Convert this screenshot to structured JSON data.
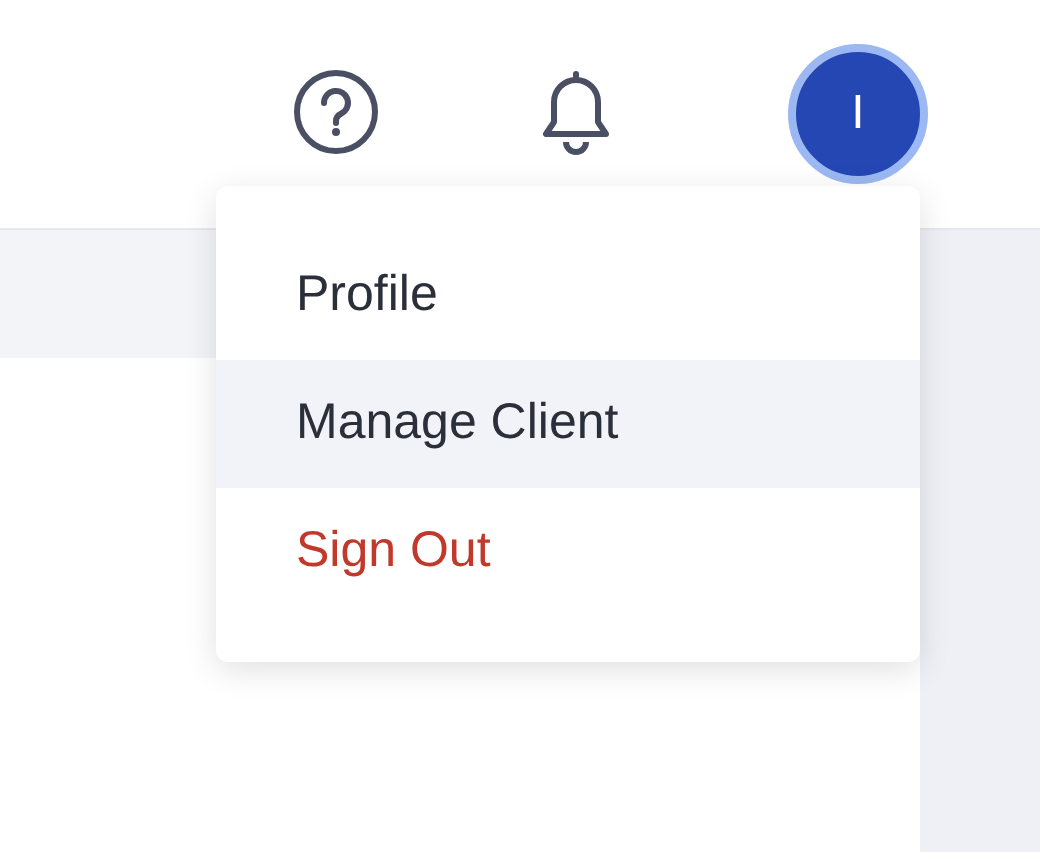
{
  "avatar": {
    "initial": "I"
  },
  "user_menu": {
    "items": [
      {
        "label": "Profile",
        "kind": "normal",
        "highlighted": false
      },
      {
        "label": "Manage Client",
        "kind": "normal",
        "highlighted": true
      },
      {
        "label": "Sign Out",
        "kind": "danger",
        "highlighted": false
      }
    ]
  }
}
